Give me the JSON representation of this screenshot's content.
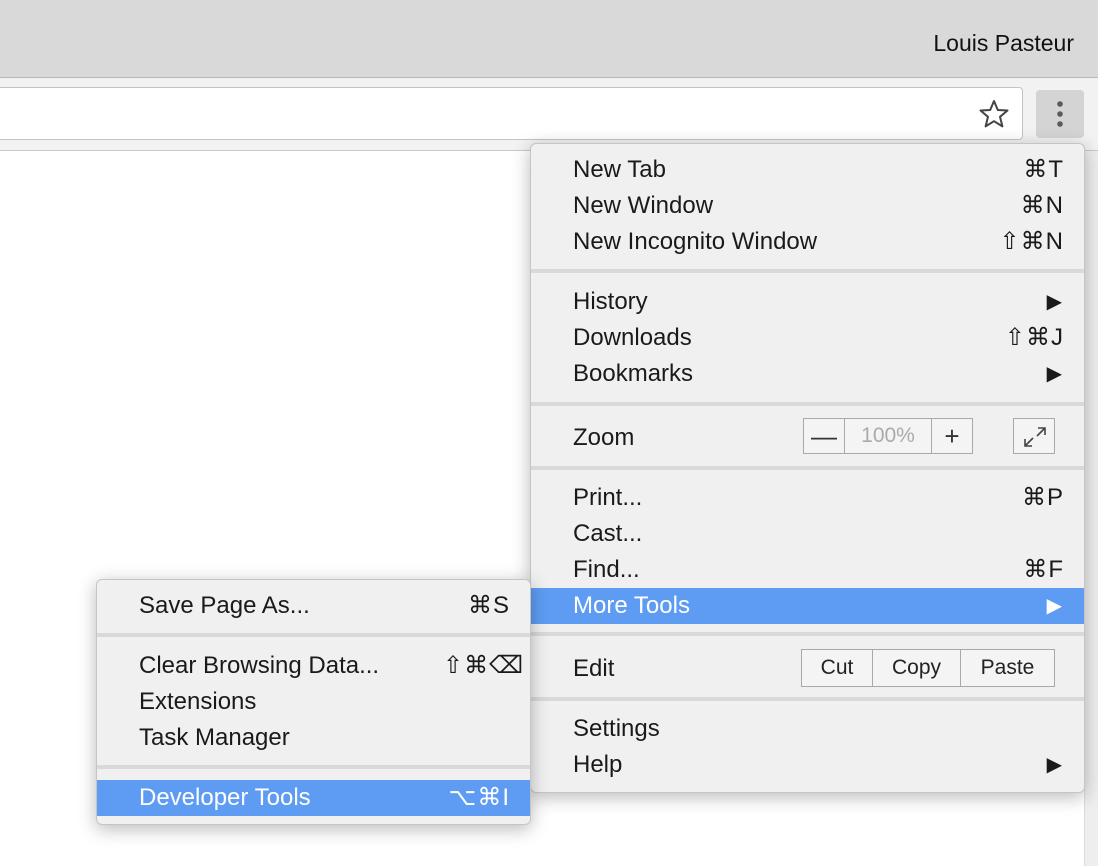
{
  "window": {
    "profile_name": "Louis Pasteur"
  },
  "toolbar": {
    "bookmark_icon": "star-icon",
    "menu_icon": "vertical-ellipsis-icon"
  },
  "main_menu": {
    "new_tab": {
      "label": "New Tab",
      "shortcut": "⌘T"
    },
    "new_window": {
      "label": "New Window",
      "shortcut": "⌘N"
    },
    "new_incognito": {
      "label": "New Incognito Window",
      "shortcut": "⇧⌘N"
    },
    "history": {
      "label": "History",
      "arrow": "▶"
    },
    "downloads": {
      "label": "Downloads",
      "shortcut": "⇧⌘J"
    },
    "bookmarks": {
      "label": "Bookmarks",
      "arrow": "▶"
    },
    "zoom": {
      "label": "Zoom",
      "minus": "—",
      "value": "100%",
      "plus": "+"
    },
    "print": {
      "label": "Print...",
      "shortcut": "⌘P"
    },
    "cast": {
      "label": "Cast..."
    },
    "find": {
      "label": "Find...",
      "shortcut": "⌘F"
    },
    "more_tools": {
      "label": "More Tools",
      "arrow": "▶"
    },
    "edit": {
      "label": "Edit",
      "cut": "Cut",
      "copy": "Copy",
      "paste": "Paste"
    },
    "settings": {
      "label": "Settings"
    },
    "help": {
      "label": "Help",
      "arrow": "▶"
    }
  },
  "more_tools_menu": {
    "save_page": {
      "label": "Save Page As...",
      "shortcut": "⌘S"
    },
    "clear_browsing": {
      "label": "Clear Browsing Data...",
      "shortcut": "⇧⌘⌫"
    },
    "extensions": {
      "label": "Extensions"
    },
    "task_manager": {
      "label": "Task Manager"
    },
    "developer_tools": {
      "label": "Developer Tools",
      "shortcut": "⌥⌘I"
    }
  },
  "colors": {
    "highlight": "#5e9cf3",
    "menu_bg": "#f0f0f0",
    "titlebar": "#d9d9d9"
  }
}
